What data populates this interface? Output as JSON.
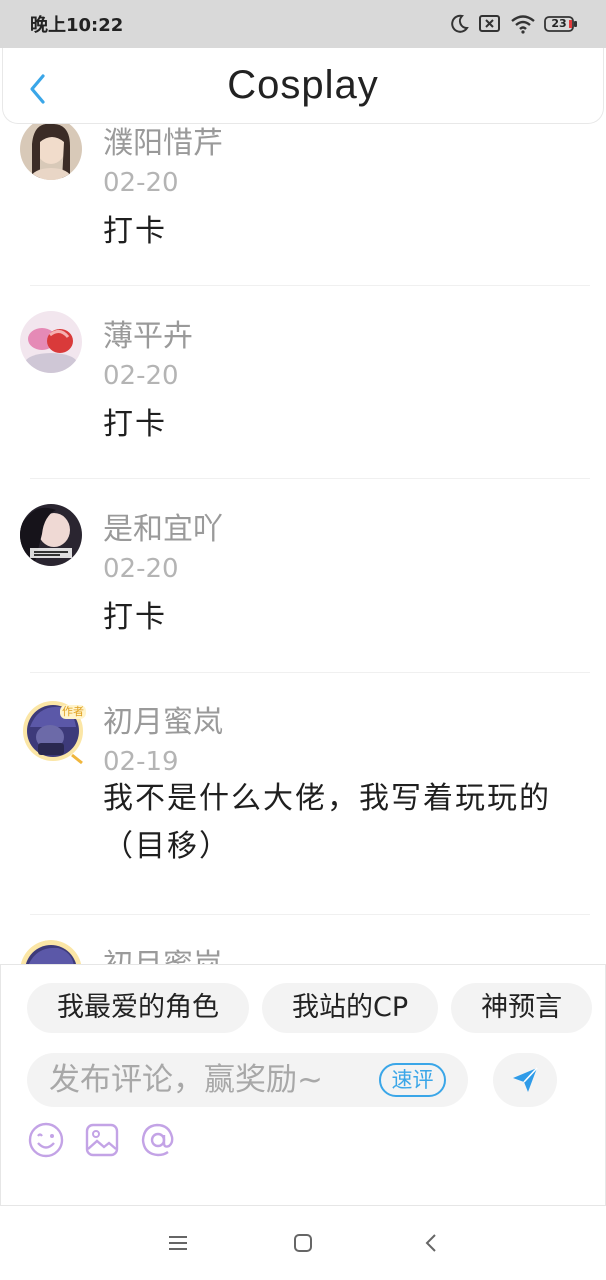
{
  "status_bar": {
    "time": "晚上10:22",
    "battery": "23",
    "icons": [
      "moon-icon",
      "sim-off-icon",
      "wifi-icon",
      "battery-icon"
    ]
  },
  "header": {
    "title": "Cosplay",
    "back_icon": "chevron-left-icon",
    "accent_color": "#3aa6e8"
  },
  "comments": [
    {
      "name": "濮阳惜芹",
      "date": "02-20",
      "text": "打卡"
    },
    {
      "name": "薄平卉",
      "date": "02-20",
      "text": "打卡"
    },
    {
      "name": "是和宜吖",
      "date": "02-20",
      "text": "打卡"
    },
    {
      "name": "初月蜜岚",
      "date": "02-19",
      "text": "我不是什么大佬，我写着玩玩的（目移）",
      "badge": "作者"
    },
    {
      "name": "初月蜜岚"
    }
  ],
  "chips": [
    "我最爱的角色",
    "我站的CP",
    "神预言"
  ],
  "composer": {
    "placeholder": "发布评论，赢奖励~",
    "quick_label": "速评",
    "send_icon": "send-icon",
    "tools": [
      "emoji-icon",
      "image-icon",
      "at-icon"
    ],
    "tool_color": "#c3a3e6"
  },
  "nav": [
    "menu-icon",
    "home-icon",
    "back-icon"
  ]
}
